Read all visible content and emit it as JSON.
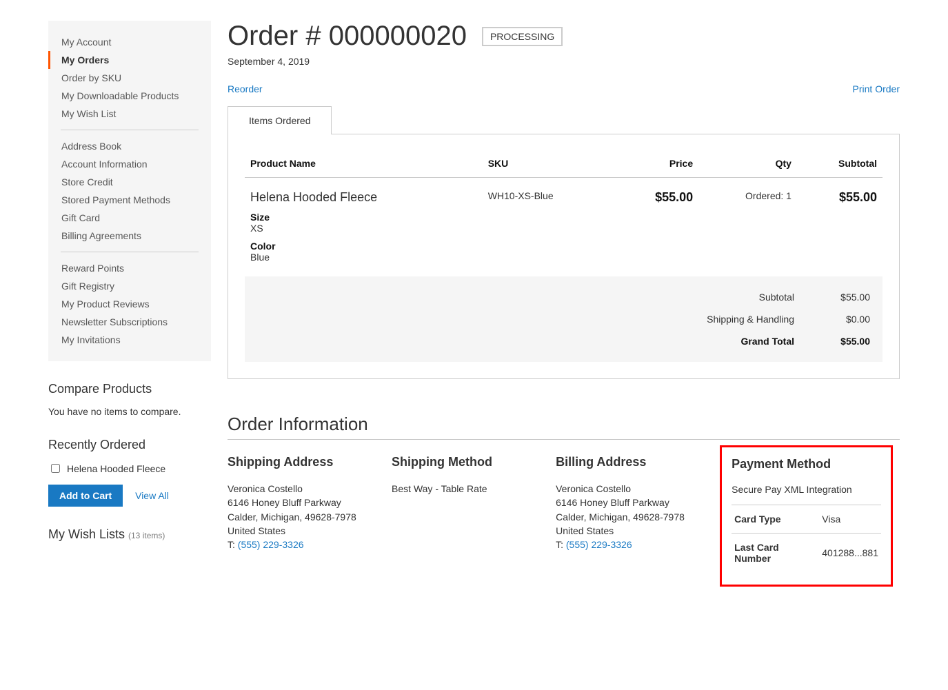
{
  "sidebar": {
    "nav": [
      "My Account",
      "My Orders",
      "Order by SKU",
      "My Downloadable Products",
      "My Wish List",
      "-",
      "Address Book",
      "Account Information",
      "Store Credit",
      "Stored Payment Methods",
      "Gift Card",
      "Billing Agreements",
      "-",
      "Reward Points",
      "Gift Registry",
      "My Product Reviews",
      "Newsletter Subscriptions",
      "My Invitations"
    ],
    "current": "My Orders"
  },
  "compare": {
    "title": "Compare Products",
    "text": "You have no items to compare."
  },
  "recent": {
    "title": "Recently Ordered",
    "items": [
      "Helena Hooded Fleece"
    ],
    "add_btn": "Add to Cart",
    "view_all": "View All"
  },
  "wishlists": {
    "title": "My Wish Lists ",
    "count": "(13 items)"
  },
  "order": {
    "title": "Order # 000000020",
    "status": "Processing",
    "date": "September 4, 2019",
    "reorder": "Reorder",
    "print": "Print Order",
    "tab": "Items Ordered",
    "headers": {
      "product": "Product Name",
      "sku": "SKU",
      "price": "Price",
      "qty": "Qty",
      "subtotal": "Subtotal"
    },
    "item": {
      "name": "Helena Hooded Fleece",
      "sku": "WH10-XS-Blue",
      "price": "$55.00",
      "qty": "Ordered: 1",
      "subtotal": "$55.00",
      "opts": [
        {
          "label": "Size",
          "value": "XS"
        },
        {
          "label": "Color",
          "value": "Blue"
        }
      ]
    },
    "totals": {
      "subtotal": {
        "label": "Subtotal",
        "value": "$55.00"
      },
      "shipping": {
        "label": "Shipping & Handling",
        "value": "$0.00"
      },
      "grand": {
        "label": "Grand Total",
        "value": "$55.00"
      }
    }
  },
  "info": {
    "title": "Order Information",
    "shipping_address": {
      "title": "Shipping Address",
      "name": "Veronica Costello",
      "street": "6146 Honey Bluff Parkway",
      "city": "Calder, Michigan, 49628-7978",
      "country": "United States",
      "tel_prefix": "T: ",
      "tel": "(555) 229-3326"
    },
    "shipping_method": {
      "title": "Shipping Method",
      "text": "Best Way - Table Rate"
    },
    "billing_address": {
      "title": "Billing Address",
      "name": "Veronica Costello",
      "street": "6146 Honey Bluff Parkway",
      "city": "Calder, Michigan, 49628-7978",
      "country": "United States",
      "tel_prefix": "T: ",
      "tel": "(555) 229-3326"
    },
    "payment": {
      "title": "Payment Method",
      "desc": "Secure Pay XML Integration",
      "rows": [
        {
          "label": "Card Type",
          "value": "Visa"
        },
        {
          "label": "Last Card Number",
          "value": "401288...881"
        }
      ]
    }
  }
}
